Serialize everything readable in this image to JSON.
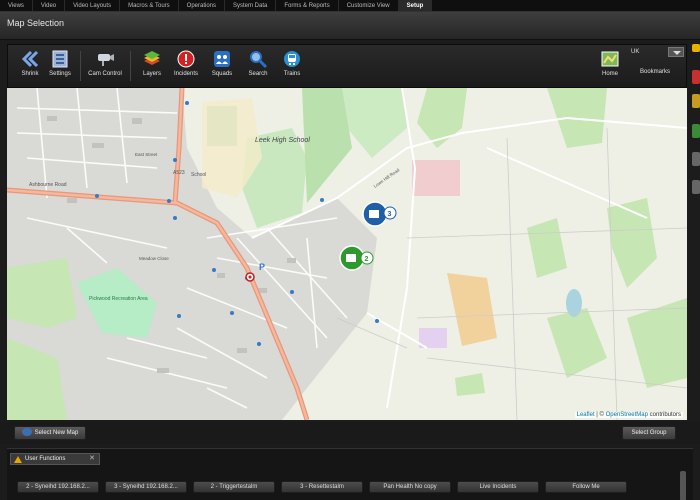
{
  "tabs": [
    {
      "label": "Views",
      "active": false
    },
    {
      "label": "Video",
      "active": false
    },
    {
      "label": "Video Layouts",
      "active": false
    },
    {
      "label": "Macros & Tours",
      "active": false
    },
    {
      "label": "Operations",
      "active": false
    },
    {
      "label": "System Data",
      "active": false
    },
    {
      "label": "Forms & Reports",
      "active": false
    },
    {
      "label": "Customize View",
      "active": false
    },
    {
      "label": "Setup",
      "active": true
    }
  ],
  "title": "Map Selection",
  "toolbar": {
    "shrink": "Shrink",
    "settings": "Settings",
    "cam_control": "Cam Control",
    "layers": "Layers",
    "incidents": "Incidents",
    "squads": "Squads",
    "search": "Search",
    "trains": "Trains",
    "home": "Home",
    "bookmarks": "Bookmarks",
    "region": "UK"
  },
  "map": {
    "labels": {
      "school": "Leek High School",
      "school2": "School",
      "rec": "Pickwood Recreation Area",
      "a523": "A523",
      "ashbourne": "Ashbourne Road",
      "east_street": "East Street",
      "meadow": "Meadow Close",
      "lowe_hill": "Lowe Hill Road"
    },
    "markers": [
      {
        "count": "3",
        "color": "#1f5fa8"
      },
      {
        "count": "2",
        "color": "#2e9a2e"
      }
    ],
    "attribution_leaflet": "Leaflet",
    "attribution_sep": " | © ",
    "attribution_osm": "OpenStreetMap",
    "attribution_tail": " contributors"
  },
  "buttons": {
    "select_new_map": "Select New Map",
    "select_group": "Select Group"
  },
  "functions": {
    "tab_label": "User Functions",
    "items": [
      "2 - Syneihd 192.168.2...",
      "3 - Syneihd 192.168.2...",
      "2 - Triggertestalm",
      "3 - Resettestalm",
      "Pan Health No copy",
      "Live Incidents",
      "Follow Me"
    ]
  }
}
